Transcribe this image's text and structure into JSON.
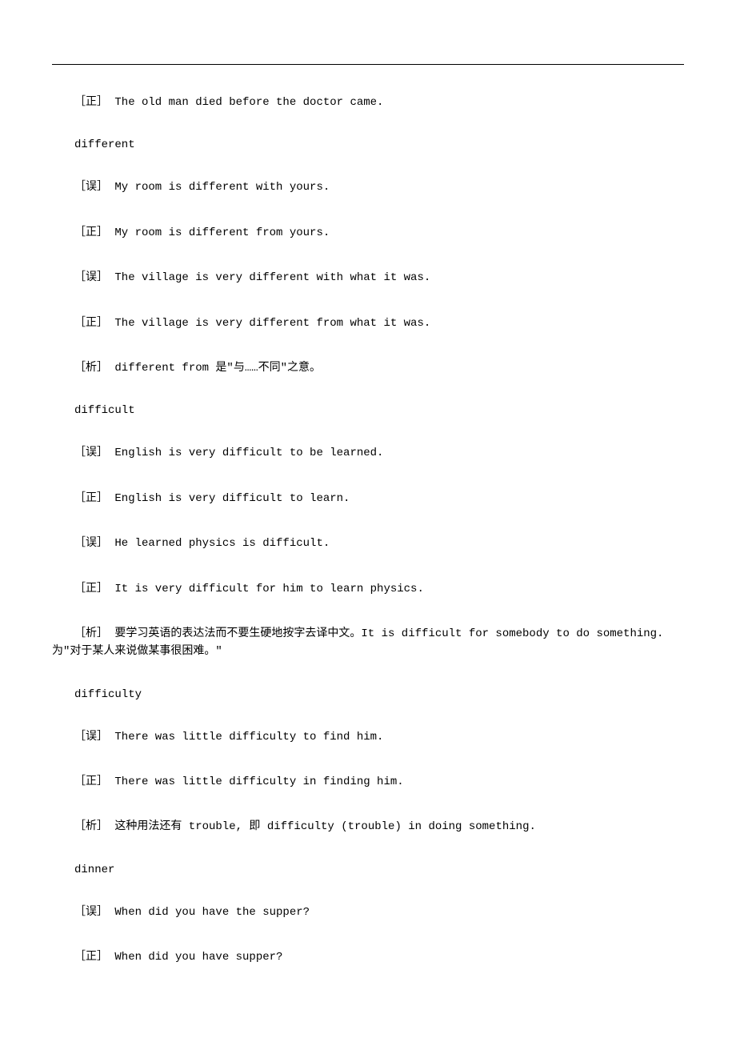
{
  "lines": [
    {
      "kind": "entry",
      "text": "［正］ The old man died before the doctor came."
    },
    {
      "kind": "word",
      "text": "different"
    },
    {
      "kind": "entry",
      "text": "［误］ My room is different with yours."
    },
    {
      "kind": "entry",
      "text": "［正］ My room is different from yours."
    },
    {
      "kind": "entry",
      "text": "［误］ The village is very different with what it was."
    },
    {
      "kind": "entry",
      "text": "［正］ The village is very different from what it was."
    },
    {
      "kind": "entry",
      "text": "［析］ different from 是\"与……不同\"之意。"
    },
    {
      "kind": "word",
      "text": "difficult"
    },
    {
      "kind": "entry",
      "text": "［误］ English is very difficult to be learned."
    },
    {
      "kind": "entry",
      "text": "［正］ English is very difficult to learn."
    },
    {
      "kind": "entry",
      "text": "［误］ He learned physics is difficult."
    },
    {
      "kind": "entry",
      "text": "［正］ It is very difficult for him to learn physics."
    },
    {
      "kind": "analysis",
      "text": "［析］ 要学习英语的表达法而不要生硬地按字去译中文。It is difficult for somebody to do something.为\"对于某人来说做某事很困难。\""
    },
    {
      "kind": "word",
      "text": "difficulty"
    },
    {
      "kind": "entry",
      "text": "［误］ There was little difficulty to find him."
    },
    {
      "kind": "entry",
      "text": "［正］ There was little difficulty in finding him."
    },
    {
      "kind": "entry",
      "text": "［析］ 这种用法还有 trouble, 即 difficulty (trouble) in doing something."
    },
    {
      "kind": "word",
      "text": "dinner"
    },
    {
      "kind": "entry",
      "text": "［误］ When did you have the supper?"
    },
    {
      "kind": "entry",
      "text": "［正］ When did you have supper?"
    }
  ]
}
